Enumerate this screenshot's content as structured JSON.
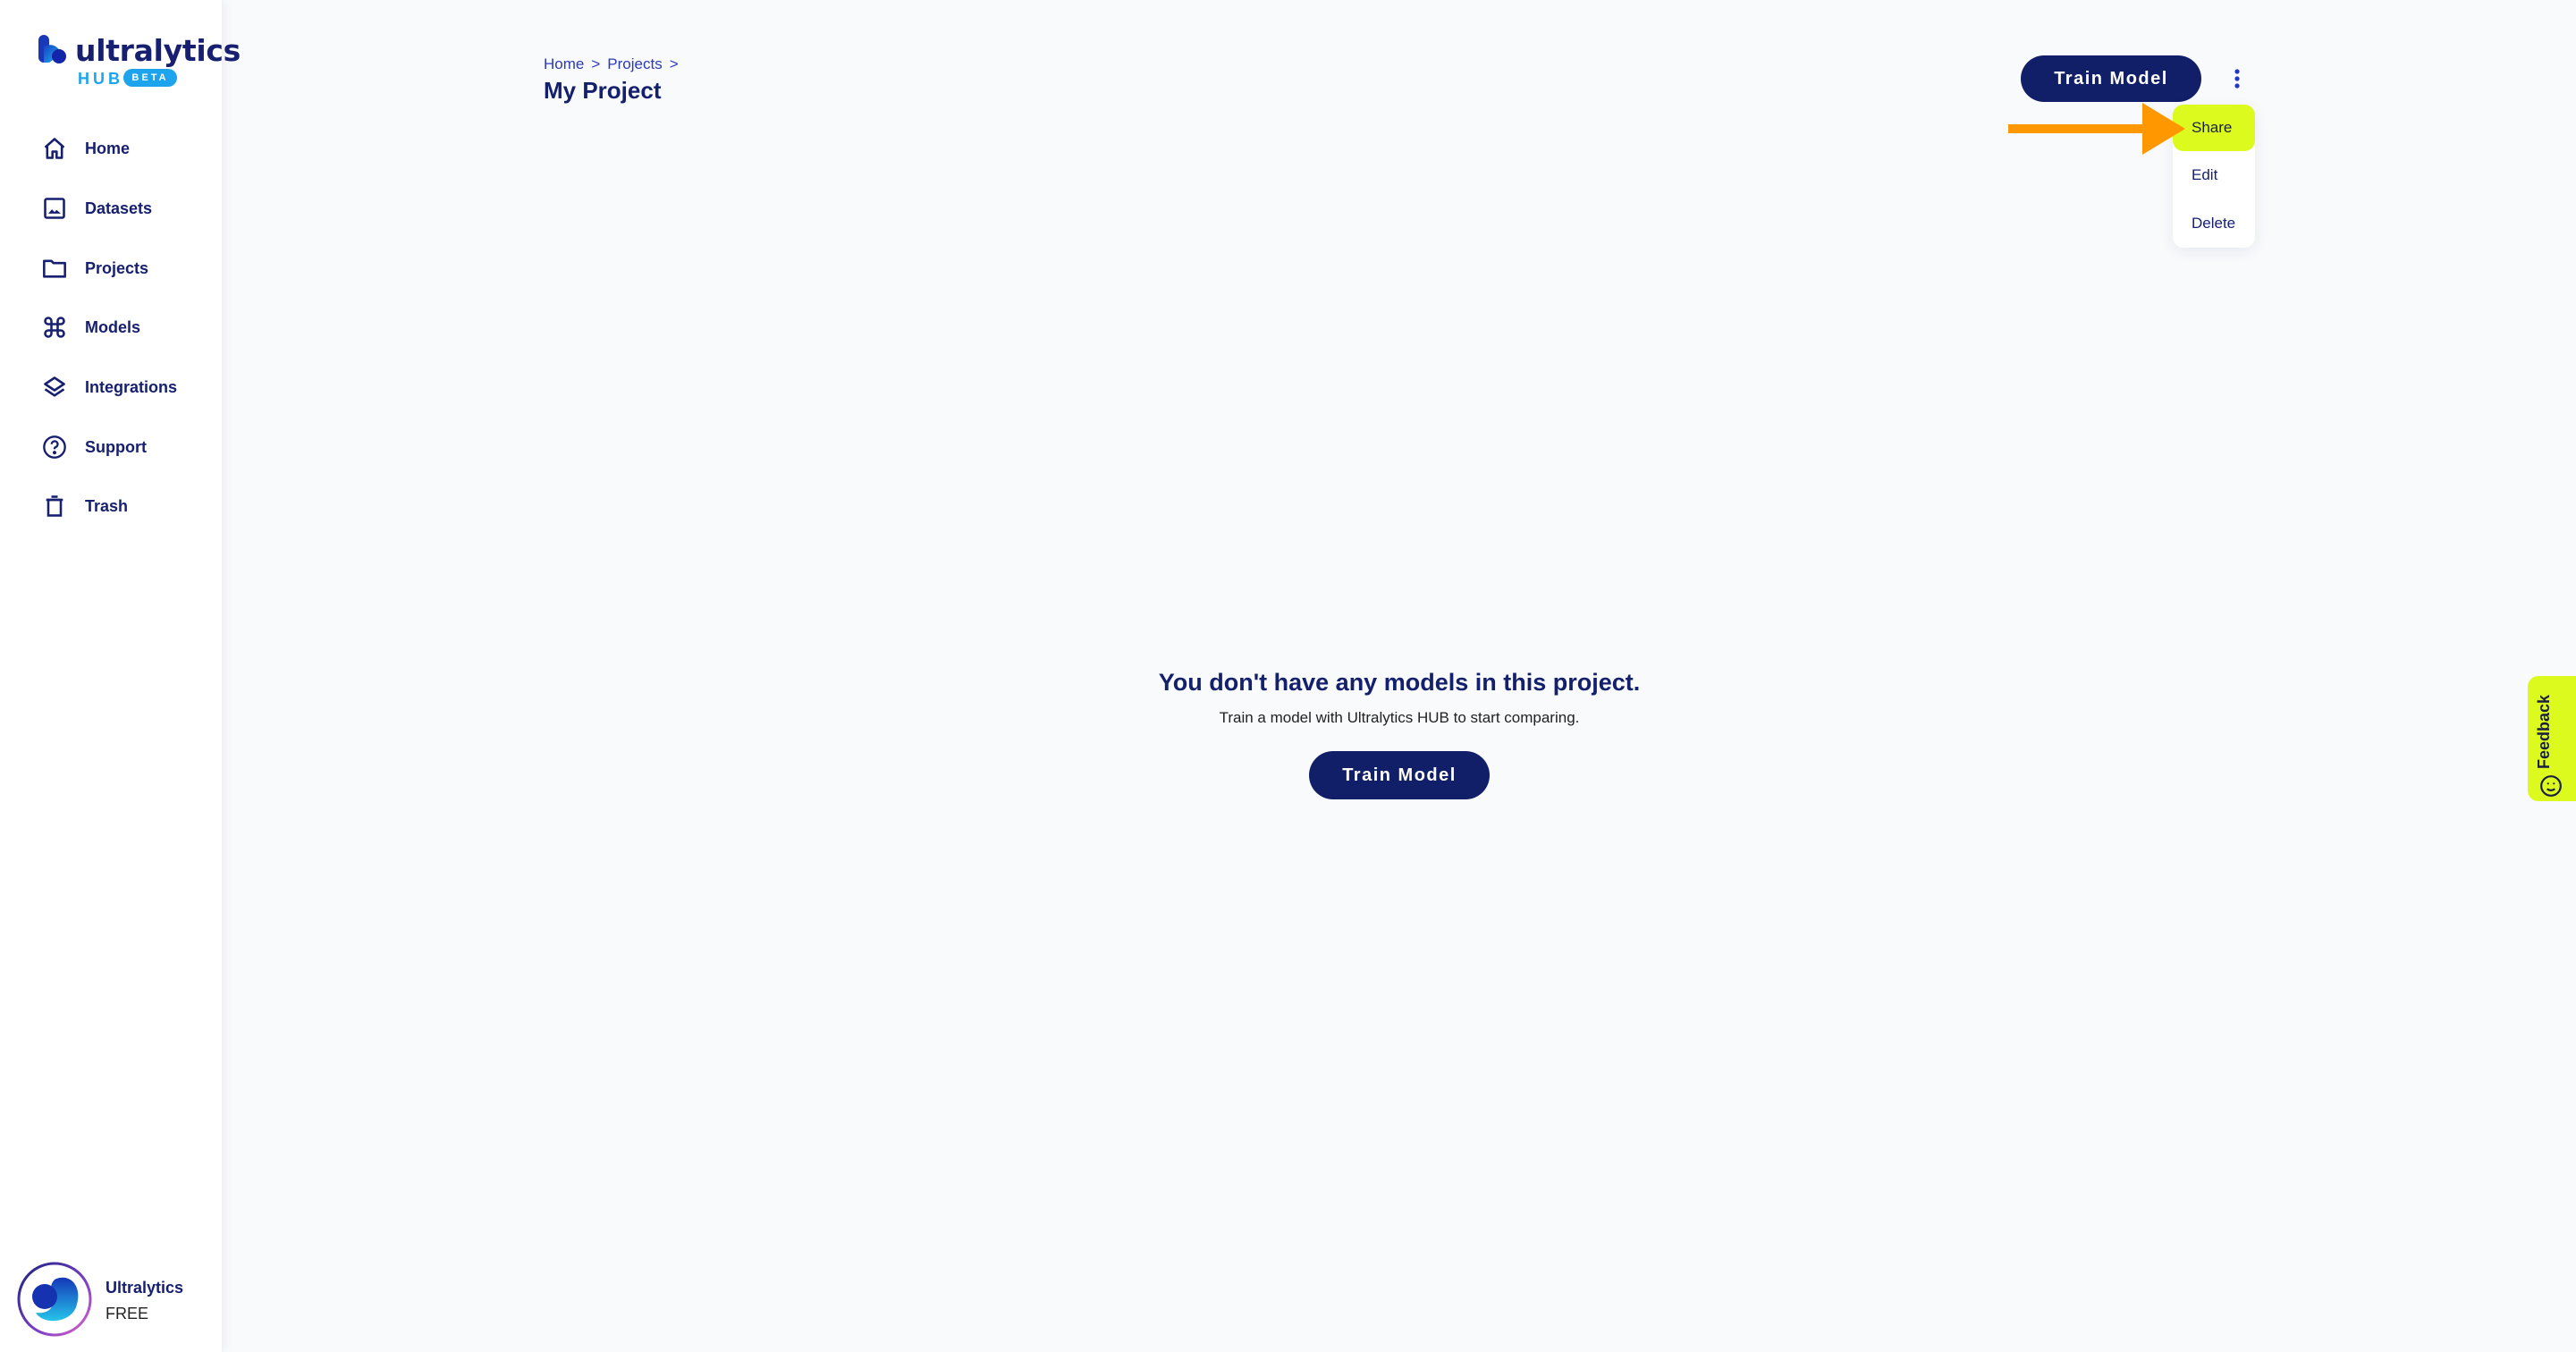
{
  "app": {
    "brand_word": "ultralytics",
    "brand_hub": "HUB",
    "brand_badge": "BETA"
  },
  "sidebar": {
    "items": [
      {
        "label": "Home",
        "icon": "home-icon"
      },
      {
        "label": "Datasets",
        "icon": "image-icon"
      },
      {
        "label": "Projects",
        "icon": "folder-icon"
      },
      {
        "label": "Models",
        "icon": "command-icon"
      },
      {
        "label": "Integrations",
        "icon": "layers-icon"
      },
      {
        "label": "Support",
        "icon": "help-circle-icon"
      },
      {
        "label": "Trash",
        "icon": "trash-icon"
      }
    ],
    "profile": {
      "name": "Ultralytics",
      "plan": "FREE"
    }
  },
  "header": {
    "breadcrumb": [
      {
        "label": "Home"
      },
      {
        "label": "Projects"
      }
    ],
    "separator": ">",
    "title": "My Project",
    "train_button": "Train Model"
  },
  "menu": {
    "items": [
      {
        "label": "Share",
        "highlighted": true
      },
      {
        "label": "Edit",
        "highlighted": false
      },
      {
        "label": "Delete",
        "highlighted": false
      }
    ]
  },
  "empty_state": {
    "title": "You don't have any models in this project.",
    "subtitle": "Train a model with Ultralytics HUB to start comparing.",
    "button": "Train Model"
  },
  "feedback": {
    "label": "Feedback"
  },
  "colors": {
    "primary": "#111f68",
    "accent_highlight": "#dcfa1e",
    "link": "#2b3bb8",
    "annotation_arrow": "#ff9700",
    "brand_blue": "#1ea4ec"
  }
}
